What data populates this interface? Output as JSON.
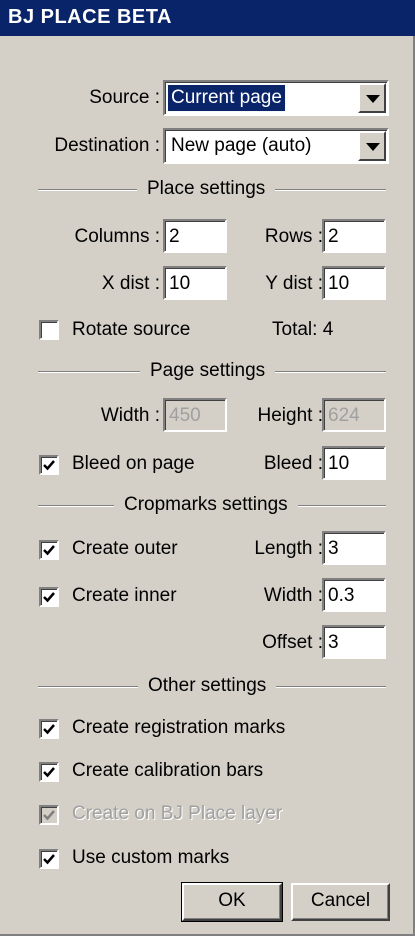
{
  "window": {
    "title": "BJ PLACE BETA"
  },
  "source": {
    "label": "Source :",
    "value": "Current page"
  },
  "destination": {
    "label": "Destination :",
    "value": "New page (auto)"
  },
  "place_settings": {
    "heading": "Place settings",
    "columns_label": "Columns :",
    "columns_value": "2",
    "rows_label": "Rows :",
    "rows_value": "2",
    "xdist_label": "X dist :",
    "xdist_value": "10",
    "ydist_label": "Y dist :",
    "ydist_value": "10",
    "rotate_label": "Rotate source",
    "rotate_checked": false,
    "total_text": "Total: 4"
  },
  "page_settings": {
    "heading": "Page settings",
    "width_label": "Width :",
    "width_value": "450",
    "height_label": "Height :",
    "height_value": "624",
    "bleed_on_page_label": "Bleed on page",
    "bleed_on_page_checked": true,
    "bleed_label": "Bleed :",
    "bleed_value": "10"
  },
  "cropmarks_settings": {
    "heading": "Cropmarks settings",
    "outer_label": "Create outer",
    "outer_checked": true,
    "length_label": "Length :",
    "length_value": "3",
    "inner_label": "Create inner",
    "inner_checked": true,
    "width_label": "Width :",
    "width_value": "0.3",
    "offset_label": "Offset :",
    "offset_value": "3"
  },
  "other_settings": {
    "heading": "Other settings",
    "registration_label": "Create registration marks",
    "registration_checked": true,
    "calibration_label": "Create calibration bars",
    "calibration_checked": true,
    "layer_label": "Create on BJ Place layer",
    "layer_checked": true,
    "layer_disabled": true,
    "custom_marks_label": "Use custom marks",
    "custom_marks_checked": true
  },
  "buttons": {
    "ok": "OK",
    "cancel": "Cancel"
  }
}
